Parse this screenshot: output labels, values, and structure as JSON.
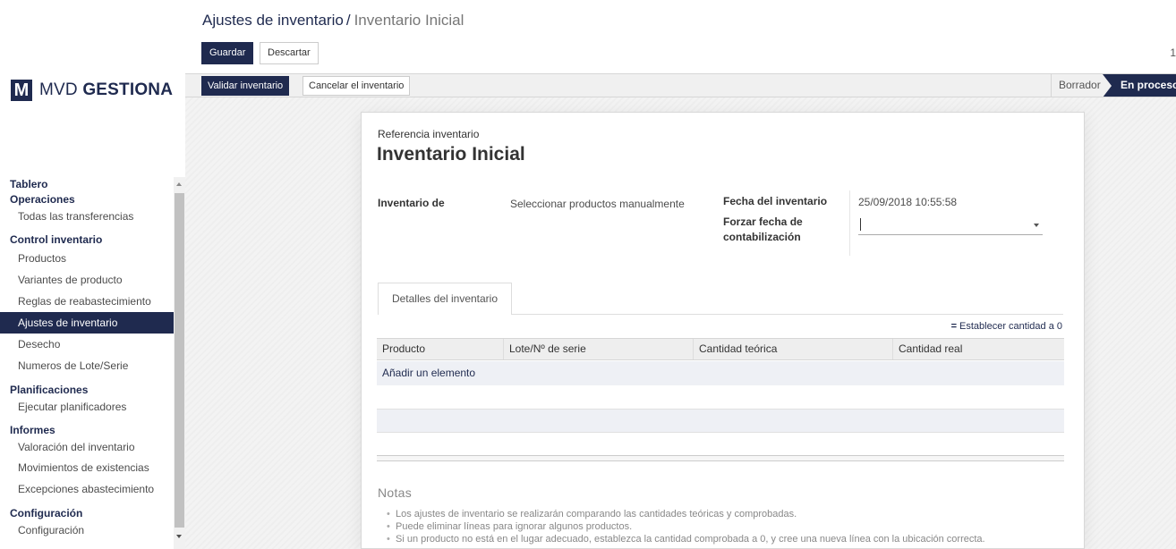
{
  "brand": {
    "mark": "M",
    "name_regular": "MVD ",
    "name_bold": "GESTIONA"
  },
  "breadcrumb": {
    "parent": "Ajustes de inventario",
    "separator": "/",
    "current": "Inventario Inicial"
  },
  "control": {
    "save_label": "Guardar",
    "discard_label": "Descartar",
    "pager": "1"
  },
  "statusbar": {
    "validate_label": "Validar inventario",
    "cancel_label": "Cancelar el inventario",
    "stages": [
      "Borrador",
      "En proceso"
    ],
    "active_stage": "En proceso"
  },
  "sidebar": {
    "sections": [
      {
        "label": "Tablero",
        "items": []
      },
      {
        "label": "Operaciones",
        "items": [
          "Todas las transferencias"
        ]
      },
      {
        "label": "Control inventario",
        "items": [
          "Productos",
          "Variantes de producto",
          "Reglas de reabastecimiento",
          "Ajustes de inventario",
          "Desecho",
          "Numeros de Lote/Serie"
        ]
      },
      {
        "label": "Planificaciones",
        "items": [
          "Ejecutar planificadores"
        ]
      },
      {
        "label": "Informes",
        "items": [
          "Valoración del inventario",
          "Movimientos de existencias",
          "Excepciones abastecimiento"
        ]
      },
      {
        "label": "Configuración",
        "items": [
          "Configuración"
        ]
      }
    ],
    "active_item": "Ajustes de inventario"
  },
  "form": {
    "ref_label": "Referencia inventario",
    "title": "Inventario Inicial",
    "inventory_of_label": "Inventario de",
    "inventory_of_value": "Seleccionar productos manualmente",
    "date_label": "Fecha del inventario",
    "date_value": "25/09/2018 10:55:58",
    "force_date_label_line1": "Forzar fecha de",
    "force_date_label_line2": "contabilización",
    "force_date_value": ""
  },
  "tabs": [
    "Detalles del inventario"
  ],
  "table": {
    "action_label": "Establecer cantidad a 0",
    "columns": [
      "Producto",
      "Lote/Nº de serie",
      "Cantidad teórica",
      "Cantidad real"
    ],
    "add_label": "Añadir un elemento"
  },
  "notes": {
    "title": "Notas",
    "items": [
      "Los ajustes de inventario se realizarán comparando las cantidades teóricas y comprobadas.",
      "Puede eliminar líneas para ignorar algunos productos.",
      "Si un producto no está en el lugar adecuado, establezca la cantidad comprobada a 0, y cree una nueva línea con la ubicación correcta."
    ]
  },
  "colors": {
    "brand": "#1f2a4f",
    "active_bg": "#1f2a4f"
  }
}
